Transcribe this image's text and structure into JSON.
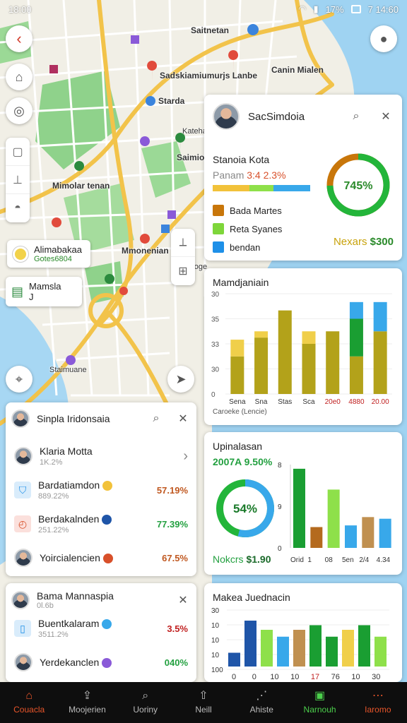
{
  "status": {
    "time": "18:00",
    "right": "17%",
    "right2": "7 14:60"
  },
  "map": {
    "labels": [
      {
        "text": "Saitnetan",
        "cls": ""
      },
      {
        "text": "Sadskiamiumurjs Lanbe",
        "cls": ""
      },
      {
        "text": "Canin Mialen",
        "cls": ""
      },
      {
        "text": "Starda",
        "cls": ""
      },
      {
        "text": "Kateha",
        "cls": "small"
      },
      {
        "text": "Saimio",
        "cls": ""
      },
      {
        "text": "Mimolar tenan",
        "cls": ""
      },
      {
        "text": "Mmonenian",
        "cls": ""
      },
      {
        "text": "Raihhoge",
        "cls": "small"
      },
      {
        "text": "Staimuane",
        "cls": "small"
      }
    ],
    "poi1": {
      "title": "Alimabakaa",
      "sub": "Gotes6804"
    },
    "poi2": {
      "title": "Mamsla",
      "sub": "J"
    }
  },
  "card_top": {
    "title": "SacSimdoia",
    "subtitle": "Stanoia Kota",
    "stat_label": "Panam",
    "stat_value": "3:4 2.3%",
    "donut_pct": 0.745,
    "donut_label": "745%",
    "legend": [
      {
        "label": "Bada Martes",
        "color": "#c8760a"
      },
      {
        "label": "Reta Syanes",
        "color": "#7ed63a"
      },
      {
        "label": "bendan",
        "color": "#1e90e8"
      }
    ],
    "footer_label": "Nexars",
    "footer_value": "$300"
  },
  "chart_data": [
    {
      "type": "bar",
      "title": "Mamdjaniain",
      "yticks": [
        "30",
        "35",
        "33",
        "30",
        "0"
      ],
      "categories": [
        "Sena",
        "Sna",
        "Stas",
        "Sca",
        "20e0",
        "4880",
        "20.00"
      ],
      "xlabel": "Caroeke (Lencie)",
      "series": [
        {
          "values": [
            18,
            27,
            40,
            24,
            30,
            18,
            30
          ],
          "color": "#b3a21a"
        },
        {
          "values": [
            8,
            3,
            0,
            6,
            0,
            0,
            0
          ],
          "color": "#f0cf4a"
        },
        {
          "values": [
            0,
            0,
            0,
            0,
            0,
            18,
            0
          ],
          "color": "#1a9e32"
        },
        {
          "values": [
            0,
            0,
            0,
            0,
            0,
            8,
            14
          ],
          "color": "#38a8ea"
        }
      ]
    },
    {
      "type": "bar",
      "title": "Makea Juednacin",
      "yticks": [
        "30",
        "10",
        "10",
        "10",
        "100"
      ],
      "categories": [
        "0",
        "0",
        "10",
        "10",
        "17",
        "76",
        "10",
        "30"
      ],
      "values": [
        6,
        20,
        16,
        13,
        16,
        18,
        13,
        16,
        18,
        13
      ],
      "colors": [
        "#1f55a8",
        "#1f55a8",
        "#8ee04a",
        "#38a8ea",
        "#c09050",
        "#1a9e32",
        "#1a9e32",
        "#f0cf4a",
        "#1a9e32",
        "#8ee04a"
      ]
    }
  ],
  "card_mid": {
    "title": "Upinalasan",
    "stat": "2007A 9.50%",
    "donut_pct": 0.54,
    "donut_label": "54%",
    "footer_label": "Nokcrs",
    "footer_value": "$1.90",
    "yticks": [
      "8",
      "9",
      "0"
    ],
    "xticks": [
      "Orid",
      "1",
      "08",
      "5en",
      "2/4",
      "4.34"
    ],
    "bars": [
      {
        "v": 0.95,
        "c": "#1a9e32"
      },
      {
        "v": 0.25,
        "c": "#b46a1e"
      },
      {
        "v": 0.7,
        "c": "#8ee04a"
      },
      {
        "v": 0.27,
        "c": "#38a8ea"
      },
      {
        "v": 0.37,
        "c": "#c09050"
      },
      {
        "v": 0.35,
        "c": "#38a8ea"
      }
    ]
  },
  "panel1": {
    "title": "Sinpla Iridonsaia",
    "rows": [
      {
        "name": "Klaria Motta",
        "sub": "1K.2%",
        "value": "",
        "value_color": "#333",
        "type": "avatar",
        "badge": ""
      },
      {
        "name": "Bardatiamdon",
        "sub": "889.22%",
        "value": "57.19%",
        "value_color": "#c05820",
        "type": "bag",
        "badge": "#f2c23a"
      },
      {
        "name": "Berdakalnden",
        "sub": "251.22%",
        "value": "77.39%",
        "value_color": "#23a040",
        "type": "clock",
        "badge": "#1f55a8"
      },
      {
        "name": "Yoircialencien",
        "sub": "",
        "value": "67.5%",
        "value_color": "#c05820",
        "type": "avatar",
        "badge": "#d8502a"
      }
    ]
  },
  "panel2": {
    "title": "Bama Mannaspia",
    "title_sub": "0l.6b",
    "rows": [
      {
        "name": "Buentkalaram",
        "sub": "3511.2%",
        "value": "3.5%",
        "value_color": "#c02020",
        "type": "bottle",
        "badge": "#38a8ea"
      },
      {
        "name": "Yerdekanclen",
        "sub": "",
        "value": "040%",
        "value_color": "#23a040",
        "type": "avatar",
        "badge": "#8a5ad8"
      }
    ]
  },
  "nav": [
    {
      "label": "Couacla",
      "icon": "home-icon",
      "glyph": "⌂",
      "color": "#e8552a"
    },
    {
      "label": "Moojerien",
      "icon": "share-icon",
      "glyph": "⇪",
      "color": "#bbbbbb"
    },
    {
      "label": "Uoriny",
      "icon": "search-icon",
      "glyph": "⌕",
      "color": "#bbbbbb"
    },
    {
      "label": "Neill",
      "icon": "navigate-icon",
      "glyph": "⇧",
      "color": "#bbbbbb"
    },
    {
      "label": "Ahiste",
      "icon": "route-icon",
      "glyph": "⋰",
      "color": "#bbbbbb"
    },
    {
      "label": "Narnouh",
      "icon": "save-icon",
      "glyph": "▣",
      "color": "#4ccf4c"
    },
    {
      "label": "Iaromo",
      "icon": "more-icon",
      "glyph": "⋯",
      "color": "#e8552a"
    }
  ]
}
